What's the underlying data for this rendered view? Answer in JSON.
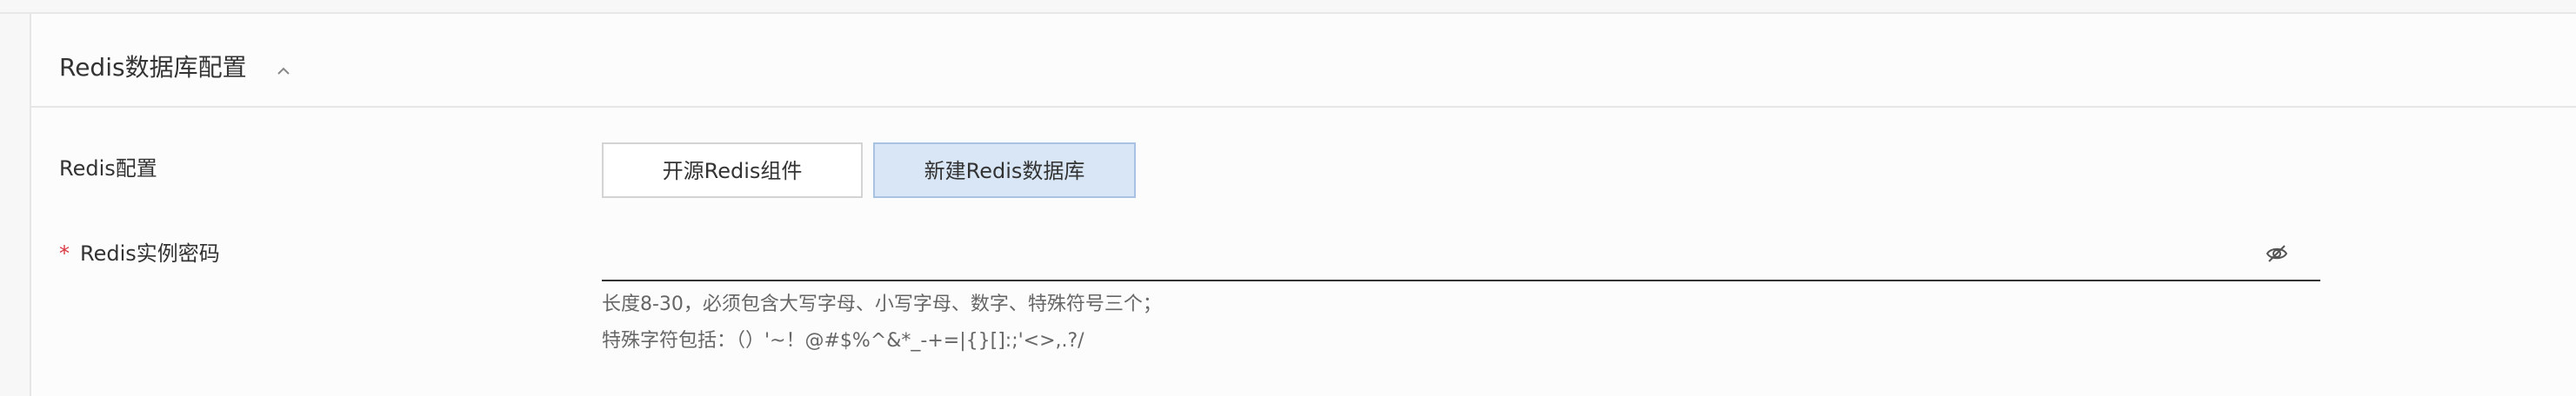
{
  "section": {
    "title": "Redis数据库配置",
    "collapse_icon": "chevron-up-icon"
  },
  "redis_config": {
    "label": "Redis配置",
    "options": [
      "开源Redis组件",
      "新建Redis数据库"
    ],
    "selected": "新建Redis数据库"
  },
  "redis_password": {
    "required_mark": "*",
    "label": "Redis实例密码",
    "value": "",
    "visibility_icon": "eye-off-icon",
    "hint_line1": "长度8-30，必须包含大写字母、小写字母、数字、特殊符号三个；",
    "hint_line2": "特殊字符包括：（）'~！@#$%^&*_-+=|{}[]:;'<>,.?/"
  },
  "colors": {
    "accent_selected_bg": "#d9e6f5",
    "accent_selected_border": "#a9c2e3",
    "required": "#d9363e"
  }
}
